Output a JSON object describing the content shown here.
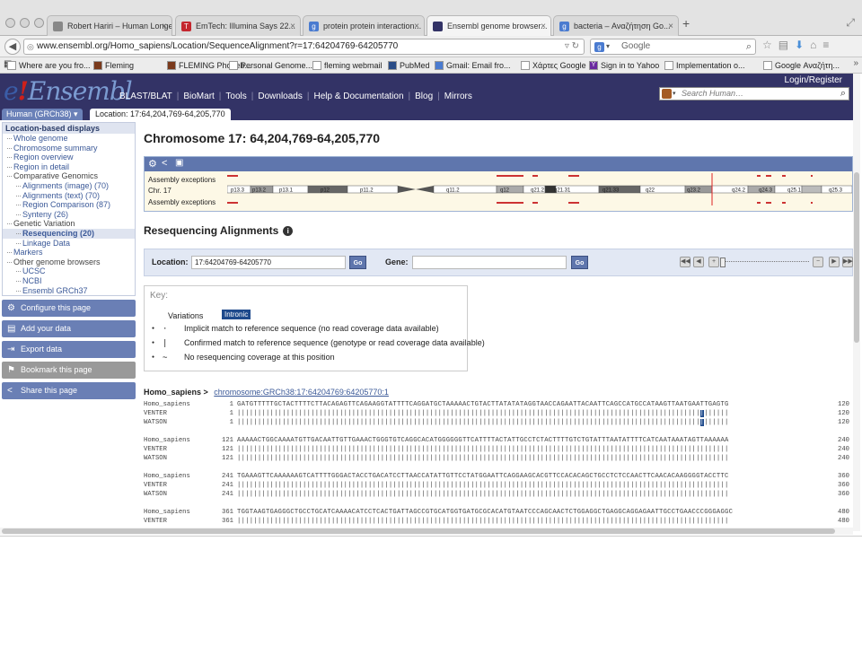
{
  "browser": {
    "tabs": [
      {
        "label": "Robert Hariri – Human Longev...",
        "favicon": "page-icon",
        "color": "#888888"
      },
      {
        "label": "EmTech: Illumina Says 22...",
        "favicon": "t-icon",
        "color": "#c4262e"
      },
      {
        "label": "protein protein interaction...",
        "favicon": "google-icon",
        "color": "#4a7bd0"
      },
      {
        "label": "Ensembl genome browser...",
        "favicon": "ensembl-icon",
        "color": "#333366"
      },
      {
        "label": "bacteria – Αναζήτηση Go...",
        "favicon": "google-icon",
        "color": "#4a7bd0"
      }
    ],
    "url": "www.ensembl.org/Homo_sapiens/Location/SequenceAlignment?r=17:64204769-64205770",
    "search_placeholder": "Google",
    "bookmarks": [
      {
        "label": "Where are you fro...",
        "icon": "page-icon"
      },
      {
        "label": "Fleming",
        "icon": "fleming-icon"
      },
      {
        "label": "FLEMING Phoneb...",
        "icon": "fleming-icon"
      },
      {
        "label": "Personal Genome...",
        "icon": "page-icon"
      },
      {
        "label": "fleming webmail",
        "icon": "page-icon"
      },
      {
        "label": "PubMed",
        "icon": "pubmed-icon"
      },
      {
        "label": "Gmail: Email fro...",
        "icon": "google-icon"
      },
      {
        "label": "Χάρτες Google",
        "icon": "page-icon"
      },
      {
        "label": "Sign in to Yahoo",
        "icon": "yahoo-icon"
      },
      {
        "label": "Implementation o...",
        "icon": "page-icon"
      },
      {
        "label": "Google Αναζήτη...",
        "icon": "page-icon"
      }
    ]
  },
  "ensembl": {
    "logo_e": "e",
    "logo_bang": "!",
    "logo_text": "Ensembl",
    "nav": [
      "BLAST/BLAT",
      "BioMart",
      "Tools",
      "Downloads",
      "Help & Documentation",
      "Blog",
      "Mirrors"
    ],
    "login": "Login/Register",
    "search_placeholder": "Search Human…",
    "species_tab": "Human (GRCh38)",
    "location_tab": "Location: 17:64,204,769-64,205,770"
  },
  "sidebar": {
    "title": "Location-based displays",
    "items": [
      {
        "label": "Whole genome",
        "level": 0,
        "link": true
      },
      {
        "label": "Chromosome summary",
        "level": 0,
        "link": true
      },
      {
        "label": "Region overview",
        "level": 0,
        "link": true
      },
      {
        "label": "Region in detail",
        "level": 0,
        "link": true
      },
      {
        "label": "Comparative Genomics",
        "level": 0,
        "link": false
      },
      {
        "label": "Alignments (image) (70)",
        "level": 1,
        "link": true
      },
      {
        "label": "Alignments (text) (70)",
        "level": 1,
        "link": true
      },
      {
        "label": "Region Comparison (87)",
        "level": 1,
        "link": true
      },
      {
        "label": "Synteny (26)",
        "level": 1,
        "link": true
      },
      {
        "label": "Genetic Variation",
        "level": 0,
        "link": false
      },
      {
        "label": "Resequencing (20)",
        "level": 1,
        "link": true,
        "selected": true
      },
      {
        "label": "Linkage Data",
        "level": 1,
        "link": true
      },
      {
        "label": "Markers",
        "level": 0,
        "link": true
      },
      {
        "label": "Other genome browsers",
        "level": 0,
        "link": false
      },
      {
        "label": "UCSC",
        "level": 1,
        "link": true
      },
      {
        "label": "NCBI",
        "level": 1,
        "link": true
      },
      {
        "label": "Ensembl GRCh37",
        "level": 1,
        "link": true
      }
    ],
    "actions": [
      {
        "label": "Configure this page",
        "icon": "gear-icon"
      },
      {
        "label": "Add your data",
        "icon": "add-data-icon"
      },
      {
        "label": "Export data",
        "icon": "export-icon"
      },
      {
        "label": "Bookmark this page",
        "icon": "bookmark-icon",
        "disabled": true
      },
      {
        "label": "Share this page",
        "icon": "share-icon"
      }
    ]
  },
  "main": {
    "title": "Chromosome 17: 64,204,769-64,205,770",
    "ideogram": {
      "assembly_exceptions": "Assembly exceptions",
      "chr_label": "Chr. 17",
      "bands": [
        "p13.3",
        "p13.2",
        "p13.1",
        "p12",
        "p11.2",
        "q11.2",
        "q12",
        "q21.2",
        "q21.31",
        "q21.33",
        "q22",
        "q23.2",
        "q24.2",
        "q24.3",
        "q25.1",
        "q25.3"
      ]
    },
    "section_title": "Resequencing Alignments",
    "form": {
      "location_label": "Location:",
      "location_value": "17:64204769-64205770",
      "gene_label": "Gene:",
      "gene_value": "",
      "go": "Go"
    },
    "key": {
      "title": "Key:",
      "variations_label": "Variations",
      "intronic": "Intronic",
      "rows": [
        {
          "sym": "·",
          "text": "Implicit match to reference sequence (no read coverage data available)"
        },
        {
          "sym": "|",
          "text": "Confirmed match to reference sequence (genotype or read coverage data available)"
        },
        {
          "sym": "~",
          "text": "No resequencing coverage at this position"
        }
      ]
    },
    "alignment": {
      "species": "Homo_sapiens >",
      "link": "chromosome:GRCh38:17:64204769:64205770:1",
      "blocks": [
        {
          "rows": [
            {
              "name": "Homo_sapiens",
              "start": "1",
              "seq": "GATGTTTTTGCTACTTTTCTTACAGAGTTCAGAAGGTATTTTCAGGATGCTAAAAACTGTACTTATATATAGGTAACCAGAATTACAATTCAGCCATGCCATAAGTTAATGAATTGAGTG",
              "end": "120"
            },
            {
              "name": "VENTER",
              "start": "1",
              "seq": "||||||||||||||||||||||||||||||||||||||||||||||||||||||||||||||||||||||||||||||||||||||||||||||||||||||||||||||||||||||||",
              "end": "120",
              "mark": 113
            },
            {
              "name": "WATSON",
              "start": "1",
              "seq": "||||||||||||||||||||||||||||||||||||||||||||||||||||||||||||||||||||||||||||||||||||||||||||||||||||||||||||||||||||||||",
              "end": "120",
              "mark": 113
            }
          ]
        },
        {
          "rows": [
            {
              "name": "Homo_sapiens",
              "start": "121",
              "seq": "AAAAACTGGCAAAATGTTGACAATTGTTGAAACTGGGTGTCAGGCACATGGGGGGTTCATTTTACTATTGCCTCTACTTTTGTCTGTATTTAATATTTTCATCAATAAATAGTTAAAAAA",
              "end": "240"
            },
            {
              "name": "VENTER",
              "start": "121",
              "seq": "||||||||||||||||||||||||||||||||||||||||||||||||||||||||||||||||||||||||||||||||||||||||||||||||||||||||||||||||||||||||",
              "end": "240"
            },
            {
              "name": "WATSON",
              "start": "121",
              "seq": "||||||||||||||||||||||||||||||||||||||||||||||||||||||||||||||||||||||||||||||||||||||||||||||||||||||||||||||||||||||||",
              "end": "240"
            }
          ]
        },
        {
          "rows": [
            {
              "name": "Homo_sapiens",
              "start": "241",
              "seq": "TGAAAGTTCAAAAAAGTCATTTTGGGACTACCTGACATCCTTAACCATATTGTTCCTATGGAATTCAGGAAGCACGTTCCACACAGCTGCCTCTCCAACTTCAACACAAGGGGTACCTTC",
              "end": "360"
            },
            {
              "name": "VENTER",
              "start": "241",
              "seq": "||||||||||||||||||||||||||||||||||||||||||||||||||||||||||||||||||||||||||||||||||||||||||||||||||||||||||||||||||||||||",
              "end": "360"
            },
            {
              "name": "WATSON",
              "start": "241",
              "seq": "||||||||||||||||||||||||||||||||||||||||||||||||||||||||||||||||||||||||||||||||||||||||||||||||||||||||||||||||||||||||",
              "end": "360"
            }
          ]
        },
        {
          "rows": [
            {
              "name": "Homo_sapiens",
              "start": "361",
              "seq": "TGGTAAGTGAGGGCTGCCTGCATCAAAACATCCTCACTGATTAGCCGTGCATGGTGATGCGCACATGTAATCCCAGCAACTCTGGAGGCTGAGGCAGGAGAATTGCCTGAACCCGGGAGGC",
              "end": "480"
            },
            {
              "name": "VENTER",
              "start": "361",
              "seq": "||||||||||||||||||||||||||||||||||||||||||||||||||||||||||||||||||||||||||||||||||||||||||||||||||||||||||||||||||||||||",
              "end": "480"
            }
          ]
        }
      ]
    }
  }
}
